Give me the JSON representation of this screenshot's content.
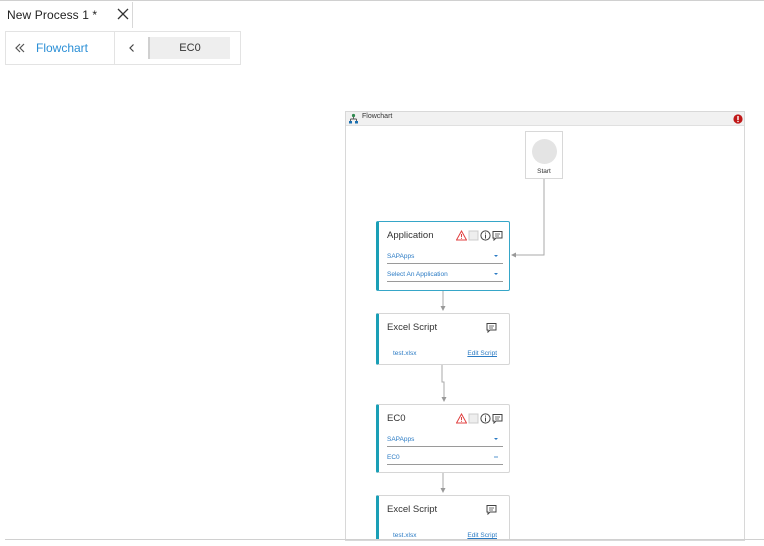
{
  "tab": {
    "title": "New Process 1 *"
  },
  "breadcrumb": {
    "link": "Flowchart",
    "current": "EC0"
  },
  "canvas": {
    "title": "Flowchart"
  },
  "start": {
    "label": "Start"
  },
  "nodes": {
    "application": {
      "title": "Application",
      "field1": "SAPApps",
      "field2": "Select An Application"
    },
    "excel1": {
      "title": "Excel Script",
      "file": "test.xlsx",
      "edit": "Edit Script"
    },
    "ec0": {
      "title": "EC0",
      "field1": "SAPApps",
      "field2": "EC0"
    },
    "excel2": {
      "title": "Excel Script",
      "file": "test.xlsx",
      "edit": "Edit Script"
    }
  },
  "colors": {
    "accent": "#1a9fb6",
    "link": "#2b8fd6",
    "error": "#c01818"
  }
}
